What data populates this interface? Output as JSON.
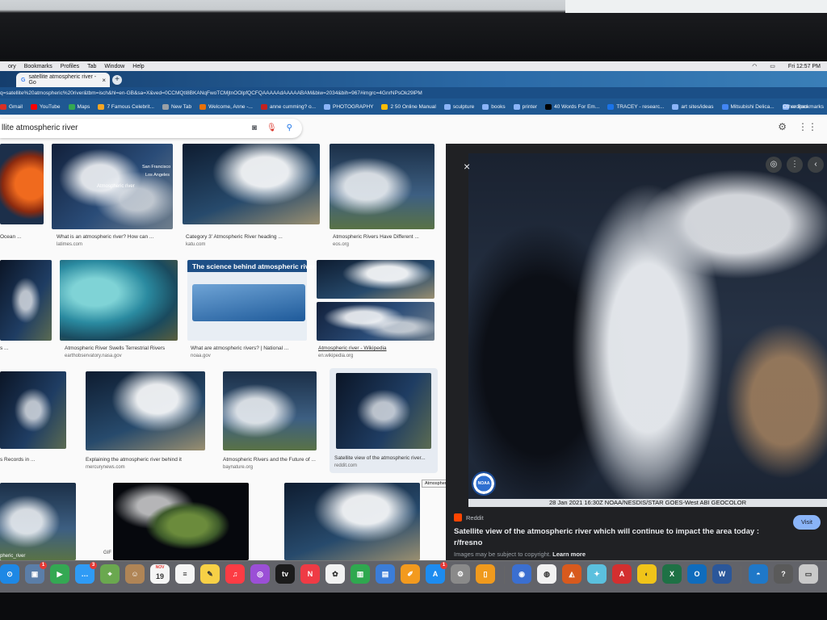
{
  "menubar": {
    "items": [
      "ory",
      "Bookmarks",
      "Profiles",
      "Tab",
      "Window",
      "Help"
    ],
    "clock": "Fri 12:57 PM"
  },
  "tab": {
    "title": "satellite atmospheric river - Go",
    "close": "×"
  },
  "newtab": "+",
  "url": "q=satellite%20atmospheric%20river&tbm=isch&hl=en-GB&sa=X&ved=0CCMQtI8BKANqFwoTCMjtnOOlpfQCFQAAAAAdAAAAABAM&biw=2034&bih=967#imgrc=4GnrNPsOk29lPM",
  "bookmarks": [
    {
      "label": "Gmail",
      "color": "#d93025"
    },
    {
      "label": "YouTube",
      "color": "#ff0000"
    },
    {
      "label": "Maps",
      "color": "#34a853"
    },
    {
      "label": "7 Famous Celebrit...",
      "color": "#f5a623"
    },
    {
      "label": "New Tab",
      "color": "#9aa0a6"
    },
    {
      "label": "Welcome, Anne -...",
      "color": "#e8710a"
    },
    {
      "label": "anne cumming? o...",
      "color": "#c5221f"
    },
    {
      "label": "PHOTOGRAPHY",
      "color": "#8ab4f8"
    },
    {
      "label": "2 50 Online Manual",
      "color": "#fbbc04"
    },
    {
      "label": "sculpture",
      "color": "#8ab4f8"
    },
    {
      "label": "books",
      "color": "#8ab4f8"
    },
    {
      "label": "printer",
      "color": "#8ab4f8"
    },
    {
      "label": "40 Words For Em...",
      "color": "#000000"
    },
    {
      "label": "TRACEY - researc...",
      "color": "#1a73e8"
    },
    {
      "label": "art sites/ideas",
      "color": "#8ab4f8"
    },
    {
      "label": "Mitsubishi Delica...",
      "color": "#4285f4"
    },
    {
      "label": "recipes",
      "color": "#8ab4f8"
    }
  ],
  "other_bookmarks": "Other Bookmarks",
  "search": {
    "query": "llite atmospheric river"
  },
  "results": [
    {
      "title": "Ocean ...",
      "source": ""
    },
    {
      "title": "What is an atmospheric river? How can ...",
      "source": "latimes.com"
    },
    {
      "title": "Category 3' Atmospheric River heading ...",
      "source": "katu.com"
    },
    {
      "title": "Atmospheric Rivers Have Different ...",
      "source": "eos.org"
    },
    {
      "title": "s ...",
      "source": ""
    },
    {
      "title": "Atmospheric River Swells Terrestrial Rivers",
      "source": "earthobservatory.nasa.gov"
    },
    {
      "title": "What are atmospheric rivers? | National ...",
      "source": "noaa.gov"
    },
    {
      "title": "Atmospheric river - Wikipedia",
      "source": "en.wikipedia.org"
    },
    {
      "title": "s Records in ...",
      "source": ""
    },
    {
      "title": "Explaining the atmospheric river behind it",
      "source": "mercurynews.com"
    },
    {
      "title": "Atmospheric Rivers and the Future of ...",
      "source": "baynature.org"
    },
    {
      "title": "Satellite view of the atmospheric river...",
      "source": "reddit.com"
    }
  ],
  "thumb_labels": {
    "atmo": "Atmospheric river",
    "sf": "San Francisco",
    "la": "Los Angeles",
    "science": "The science behind atmospheric rivers",
    "row4_left": "pheric_river",
    "gif": "GIF"
  },
  "tooltip": "Atmospheric river - Wikipedia",
  "detail": {
    "close": "×",
    "caption": "28 Jan 2021 16:30Z NOAA/NESDIS/STAR GOES-West ABI GEOCOLOR",
    "noaa": "NOAA",
    "source": "Reddit",
    "title": "Satellite view of the atmospheric river which will continue to impact the area today : r/fresno",
    "visit": "Visit",
    "copyright": "Images may be subject to copyright.",
    "learn_more": "Learn more"
  },
  "dock": [
    {
      "name": "safari",
      "color": "#1e88e5",
      "glyph": "⊙"
    },
    {
      "name": "preview",
      "color": "#5b7ea8",
      "glyph": "▣",
      "badge": "1"
    },
    {
      "name": "facetime",
      "color": "#34a853",
      "glyph": "▶"
    },
    {
      "name": "messages",
      "color": "#2f9bf5",
      "glyph": "…",
      "badge": "3"
    },
    {
      "name": "maps",
      "color": "#6aa84f",
      "glyph": "⌖"
    },
    {
      "name": "contacts",
      "color": "#b08556",
      "glyph": "☺"
    },
    {
      "name": "calendar",
      "color": "#f5f5f5",
      "glyph": "19",
      "dark": true,
      "top": "NOV"
    },
    {
      "name": "reminders",
      "color": "#f5f5f5",
      "glyph": "≡",
      "dark": true
    },
    {
      "name": "notes",
      "color": "#f7d046",
      "glyph": "✎",
      "dark": true
    },
    {
      "name": "music",
      "color": "#fc3c44",
      "glyph": "♫"
    },
    {
      "name": "podcasts",
      "color": "#9b4fd6",
      "glyph": "◎"
    },
    {
      "name": "tv",
      "color": "#1b1b1b",
      "glyph": "tv"
    },
    {
      "name": "news",
      "color": "#ef3b45",
      "glyph": "N"
    },
    {
      "name": "photos",
      "color": "#f2f2f2",
      "glyph": "✿",
      "dark": true
    },
    {
      "name": "numbers",
      "color": "#2fa84f",
      "glyph": "▥"
    },
    {
      "name": "keynote",
      "color": "#3b7dd8",
      "glyph": "▤"
    },
    {
      "name": "pages",
      "color": "#f39a1e",
      "glyph": "✐"
    },
    {
      "name": "app-store",
      "color": "#1d8cf0",
      "glyph": "A",
      "badge": "1"
    },
    {
      "name": "system-preferences",
      "color": "#8a8a8a",
      "glyph": "⚙"
    },
    {
      "name": "books",
      "color": "#f09a1d",
      "glyph": "▯"
    },
    {
      "name": "compass",
      "color": "#3b6fd0",
      "glyph": "◉"
    },
    {
      "name": "chrome",
      "color": "#f2f2f2",
      "glyph": "◍",
      "dark": true
    },
    {
      "name": "photo-editor",
      "color": "#d85a1e",
      "glyph": "◭"
    },
    {
      "name": "paint",
      "color": "#5bc0de",
      "glyph": "✦"
    },
    {
      "name": "acrobat",
      "color": "#d32f2f",
      "glyph": "A"
    },
    {
      "name": "audio",
      "color": "#f0c419",
      "glyph": "◐",
      "dark": true
    },
    {
      "name": "excel",
      "color": "#1e7145",
      "glyph": "X"
    },
    {
      "name": "outlook",
      "color": "#0f6cbd",
      "glyph": "O"
    },
    {
      "name": "word",
      "color": "#2b579a",
      "glyph": "W"
    },
    {
      "name": "network",
      "color": "#1f78c8",
      "glyph": "◓"
    },
    {
      "name": "help",
      "color": "#5a5a5a",
      "glyph": "?"
    },
    {
      "name": "trash",
      "color": "#c9c9c9",
      "glyph": "▭",
      "dark": true
    }
  ]
}
